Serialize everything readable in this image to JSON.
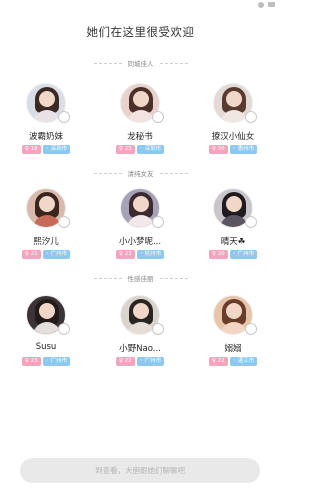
{
  "page_title": "她们在这里很受欢迎",
  "sections": [
    {
      "title": "同城佳人"
    },
    {
      "title": "清纯女友"
    },
    {
      "title": "性感佳丽"
    }
  ],
  "cards": [
    {
      "name": "波霸奶妹",
      "age": "♀ 18",
      "city": "◦ 深圳市",
      "colors": {
        "bg": "#d9dde6",
        "hair": "#3b2a24",
        "body": "#e8e2e6"
      }
    },
    {
      "name": "龙秘书",
      "age": "♀ 23",
      "city": "◦ 深圳市",
      "colors": {
        "bg": "#e8d2cc",
        "hair": "#4a3028",
        "body": "#f3e3de"
      }
    },
    {
      "name": "撩汉小仙女",
      "age": "♀ 20",
      "city": "◦ 惠州市",
      "colors": {
        "bg": "#e2dad4",
        "hair": "#5a3b2f",
        "body": "#f0e6e2"
      }
    },
    {
      "name": "熙汐儿",
      "age": "♀ 21",
      "city": "◦ 广州市",
      "colors": {
        "bg": "#d8b9ac",
        "hair": "#3a261f",
        "body": "#c76a5a"
      }
    },
    {
      "name": "小小梦呢...",
      "age": "♀ 23",
      "city": "◦ 杭州市",
      "colors": {
        "bg": "#a6a3b8",
        "hair": "#3b2b30",
        "body": "#f2e8ea"
      }
    },
    {
      "name": "晴天☘",
      "age": "♀ 20",
      "city": "◦ 广州市",
      "colors": {
        "bg": "#c9c6cb",
        "hair": "#1f1b1e",
        "body": "#5a5560"
      }
    },
    {
      "name": "Susu",
      "age": "♀ 23",
      "city": "◦ 广州市",
      "colors": {
        "bg": "#3b3336",
        "hair": "#221b1c",
        "body": "#e6dede"
      }
    },
    {
      "name": "小野Nao...",
      "age": "♀ 22",
      "city": "◦ 广州市",
      "colors": {
        "bg": "#d9d4cc",
        "hair": "#2a2422",
        "body": "#e5ddd6"
      }
    },
    {
      "name": "嫋嫋",
      "age": "♀ 22",
      "city": "◦ 湛江市",
      "colors": {
        "bg": "#e8c4a8",
        "hair": "#6a3d2a",
        "body": "#f2d6c2"
      }
    }
  ],
  "bottom_button": "到查看，大胆跟她们聊聊吧"
}
